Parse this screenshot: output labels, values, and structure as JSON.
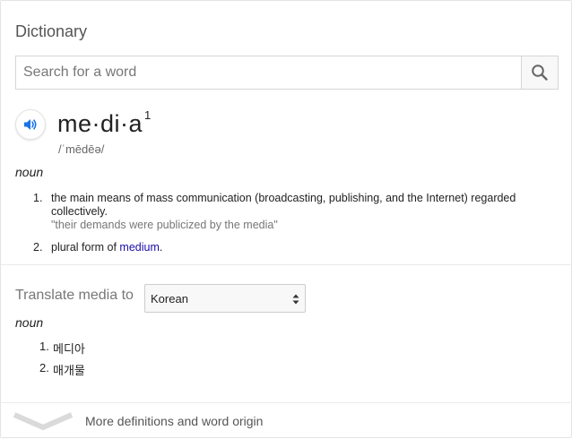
{
  "panel": {
    "title": "Dictionary"
  },
  "search": {
    "placeholder": "Search for a word",
    "value": "",
    "button_icon": "search-icon"
  },
  "entry": {
    "speaker_icon": "speaker-icon",
    "headword": "me·di·a",
    "homograph_number": "1",
    "phonetic": "/ˈmēdēə/",
    "part_of_speech": "noun",
    "definitions": [
      {
        "number": "1.",
        "text": "the main means of mass communication (broadcasting, publishing, and the Internet) regarded collectively.",
        "example": "\"their demands were publicized by the media\""
      },
      {
        "number": "2.",
        "text_before": "plural form of ",
        "link": "medium",
        "text_after": "."
      }
    ]
  },
  "translate": {
    "label": "Translate media to",
    "selected_language": "Korean",
    "part_of_speech": "noun",
    "translations": [
      {
        "number": "1.",
        "text": "메디아"
      },
      {
        "number": "2.",
        "text": "매개물"
      }
    ]
  },
  "footer": {
    "chevron_icon": "chevron-down-icon",
    "label": "More definitions and word origin"
  },
  "colors": {
    "link": "#1a0dab",
    "speaker_accent": "#1a73e8",
    "muted_text": "#777777"
  }
}
